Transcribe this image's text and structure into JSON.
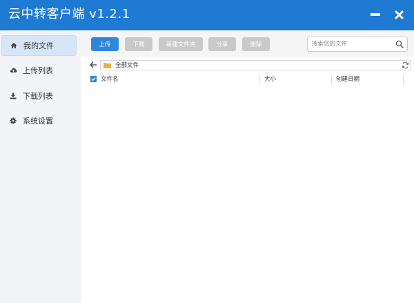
{
  "app": {
    "title": "云中转客户端 v1.2.1"
  },
  "window_controls": {
    "minimize": "minimize-icon",
    "close": "close-icon"
  },
  "sidebar": {
    "items": [
      {
        "label": "我的文件",
        "icon": "home-icon",
        "active": true
      },
      {
        "label": "上传列表",
        "icon": "cloud-upload-icon",
        "active": false
      },
      {
        "label": "下载列表",
        "icon": "download-icon",
        "active": false
      },
      {
        "label": "系统设置",
        "icon": "gear-icon",
        "active": false
      }
    ]
  },
  "toolbar": {
    "upload_label": "上传",
    "download_label": "下载",
    "new_folder_label": "新建文件夹",
    "share_label": "分享",
    "delete_label": "删除"
  },
  "search": {
    "placeholder": "搜索您的文件"
  },
  "path": {
    "current": "全部文件"
  },
  "table": {
    "columns": [
      "文件名",
      "大小",
      "创建日期"
    ]
  },
  "colors": {
    "accent": "#1e7ad3",
    "primary_button": "#2f86dd",
    "disabled_button": "#c9c9c9",
    "folder": "#e8b33d"
  }
}
